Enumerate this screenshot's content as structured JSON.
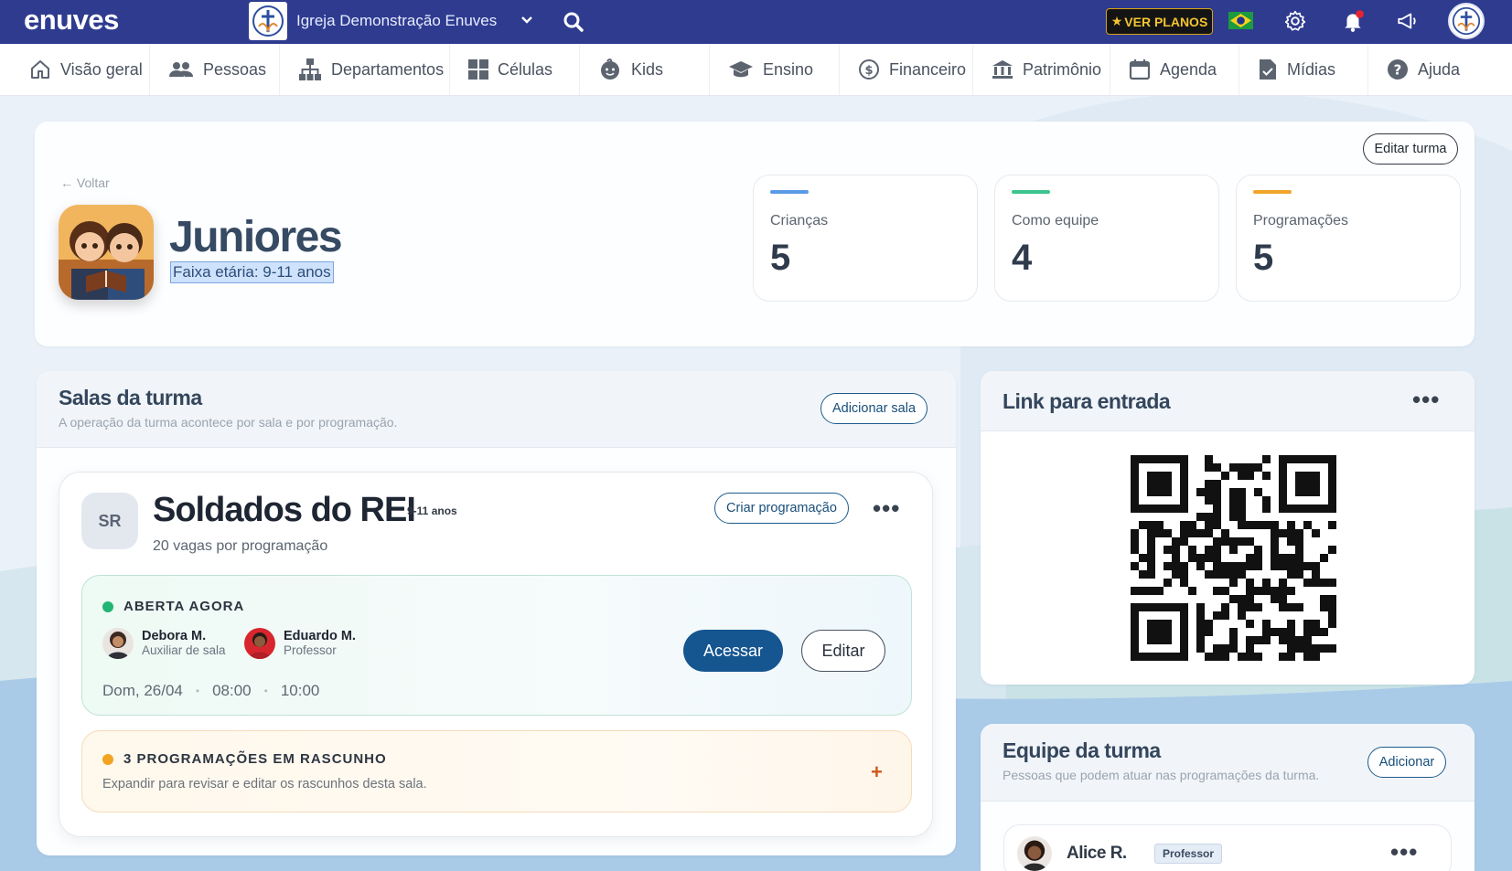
{
  "topbar": {
    "brand": "enuves",
    "org_name": "Igreja Demonstração Enuves",
    "plans_label": "VER PLANOS",
    "plans_star": "★"
  },
  "nav": {
    "items": [
      {
        "label": "Visão geral",
        "icon": "home-icon"
      },
      {
        "label": "Pessoas",
        "icon": "people-icon"
      },
      {
        "label": "Departamentos",
        "icon": "org-chart-icon"
      },
      {
        "label": "Células",
        "icon": "grid-icon"
      },
      {
        "label": "Kids",
        "icon": "kids-icon"
      },
      {
        "label": "Ensino",
        "icon": "graduation-cap-icon"
      },
      {
        "label": "Financeiro",
        "icon": "dollar-icon"
      },
      {
        "label": "Patrimônio",
        "icon": "bank-icon"
      },
      {
        "label": "Agenda",
        "icon": "calendar-icon"
      },
      {
        "label": "Mídias",
        "icon": "file-icon"
      },
      {
        "label": "Ajuda",
        "icon": "help-icon"
      }
    ]
  },
  "header": {
    "back_label": "← Voltar",
    "title": "Juniores",
    "subtitle": "Faixa etária: 9-11 anos",
    "edit_label": "Editar turma",
    "stats": [
      {
        "label": "Crianças",
        "value": "5",
        "color": "#5a9ae6"
      },
      {
        "label": "Como equipe",
        "value": "4",
        "color": "#3cc48f"
      },
      {
        "label": "Programações",
        "value": "5",
        "color": "#f0a52a"
      }
    ]
  },
  "salas": {
    "title": "Salas da turma",
    "subtitle": "A operação da turma acontece por sala e por programação.",
    "add_label": "Adicionar sala",
    "room": {
      "badge": "SR",
      "name": "Soldados do REI",
      "age": "9-11 anos",
      "capacity": "20 vagas por programação",
      "create_label": "Criar programação",
      "more": "•••",
      "open": {
        "status": "ABERTA AGORA",
        "people": [
          {
            "name": "Debora M.",
            "role": "Auxiliar de sala"
          },
          {
            "name": "Eduardo M.",
            "role": "Professor"
          }
        ],
        "date": "Dom, 26/04",
        "start": "08:00",
        "end": "10:00",
        "sep": "•",
        "access_label": "Acessar",
        "edit_label": "Editar"
      },
      "draft": {
        "status": "3 PROGRAMAÇÕES EM RASCUNHO",
        "description": "Expandir para revisar e editar os rascunhos desta sala.",
        "plus": "+"
      }
    }
  },
  "link": {
    "title": "Link para entrada",
    "more": "•••"
  },
  "team": {
    "title": "Equipe da turma",
    "subtitle": "Pessoas que podem atuar nas programações da turma.",
    "add_label": "Adicionar",
    "member": {
      "name": "Alice R.",
      "role": "Professor"
    },
    "more": "•••"
  },
  "colors": {
    "topbar": "#2e3b8f",
    "primary": "#155590",
    "open_dot": "#22b573",
    "draft_dot": "#f2a322"
  }
}
